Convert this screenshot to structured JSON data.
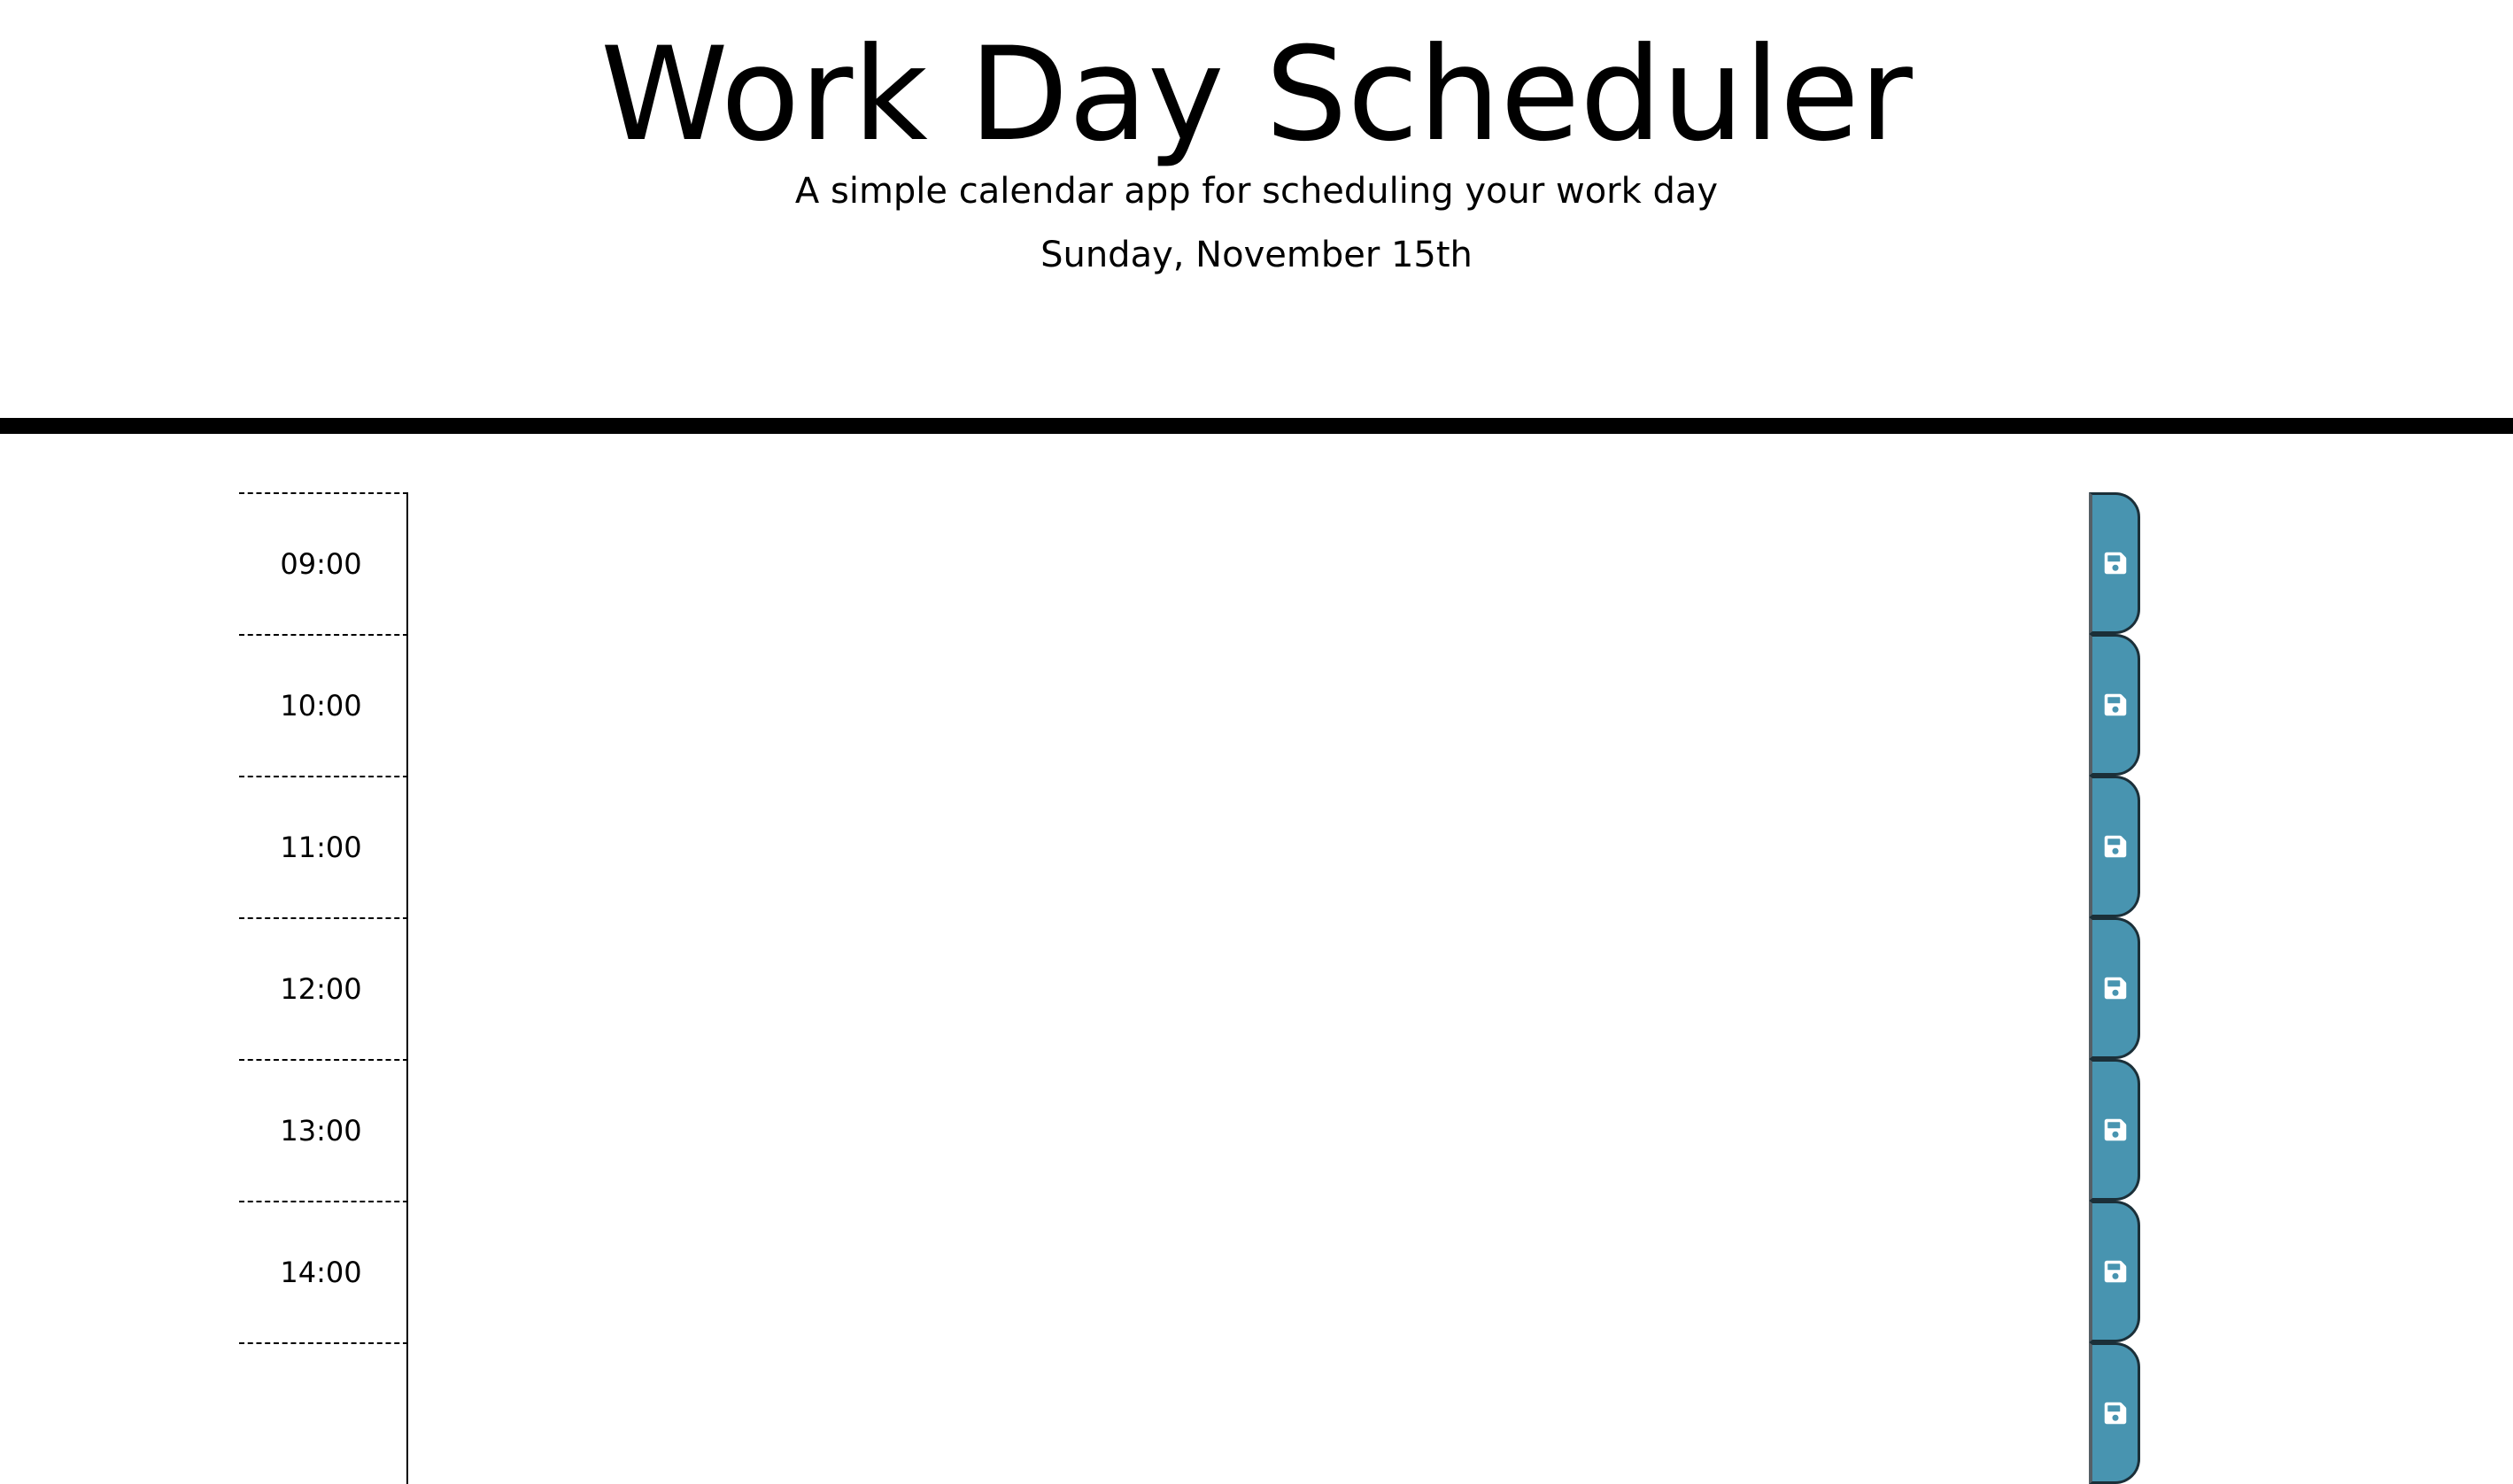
{
  "header": {
    "title": "Work Day Scheduler",
    "subtitle": "A simple calendar app for scheduling your work day",
    "current_day": "Sunday, November 15th"
  },
  "colors": {
    "save_button": "#4894b0",
    "divider": "#000000",
    "save_icon": "#ffffff"
  },
  "time_blocks": [
    {
      "hour": "09:00",
      "description": "",
      "save_icon": "floppy-disk-icon"
    },
    {
      "hour": "10:00",
      "description": "",
      "save_icon": "floppy-disk-icon"
    },
    {
      "hour": "11:00",
      "description": "",
      "save_icon": "floppy-disk-icon"
    },
    {
      "hour": "12:00",
      "description": "",
      "save_icon": "floppy-disk-icon"
    },
    {
      "hour": "13:00",
      "description": "",
      "save_icon": "floppy-disk-icon"
    },
    {
      "hour": "14:00",
      "description": "",
      "save_icon": "floppy-disk-icon"
    },
    {
      "hour": "",
      "description": "",
      "save_icon": "floppy-disk-icon"
    }
  ]
}
